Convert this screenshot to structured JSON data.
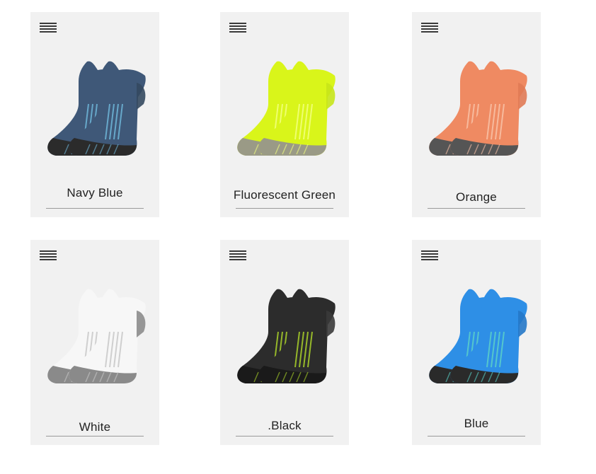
{
  "products": [
    {
      "label": "Navy Blue",
      "icon": "sock-pair-icon",
      "colors": {
        "body": "#3f5878",
        "stripe": "#6fb6d8",
        "sole": "#2b2b2b",
        "heel": "#34495f"
      }
    },
    {
      "label": "Fluorescent Green",
      "icon": "sock-pair-icon",
      "colors": {
        "body": "#d9f51a",
        "stripe": "#f2ff80",
        "sole": "#9a9a86",
        "heel": "#c6e51a"
      }
    },
    {
      "label": "Orange",
      "icon": "sock-pair-icon",
      "colors": {
        "body": "#ef8a62",
        "stripe": "#f8c2a8",
        "sole": "#555555",
        "heel": "#e07a55"
      }
    },
    {
      "label": "White",
      "icon": "sock-pair-icon",
      "colors": {
        "body": "#f7f7f7",
        "stripe": "#c8c8c8",
        "sole": "#8a8a8a",
        "heel": "#8c8c8c"
      }
    },
    {
      "label": ".Black",
      "icon": "sock-pair-icon",
      "colors": {
        "body": "#2c2c2c",
        "stripe": "#a9d12a",
        "sole": "#1a1a1a",
        "heel": "#3a3a3a"
      }
    },
    {
      "label": "Blue",
      "icon": "sock-pair-icon",
      "colors": {
        "body": "#2e8fe6",
        "stripe": "#5ad0c8",
        "sole": "#2a2a2a",
        "heel": "#2578c8"
      }
    }
  ],
  "menu_icon": "hamburger-menu-icon"
}
